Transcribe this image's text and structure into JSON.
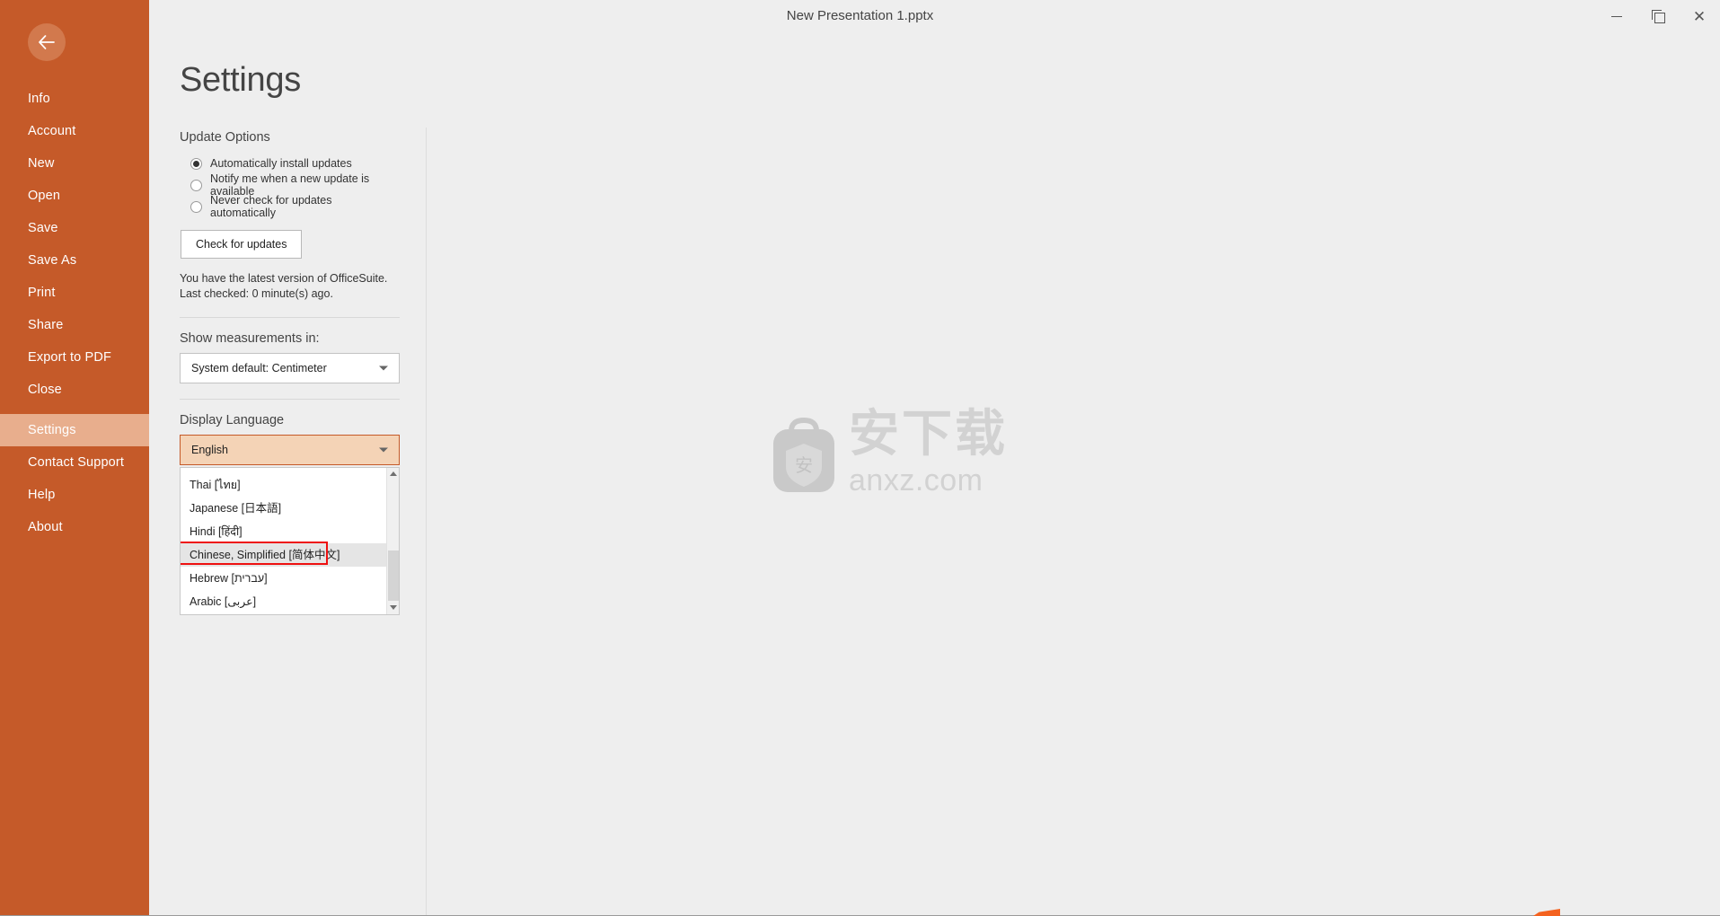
{
  "window": {
    "title": "New Presentation 1.pptx",
    "controls": {
      "minimize": "Minimize",
      "restore": "Restore",
      "close": "✕"
    }
  },
  "colors": {
    "sidebar_bg": "#c55a29",
    "sidebar_active_bg": "#e8ae8d",
    "accent_field_bg": "#f4d3b6",
    "accent_border": "#c55a29",
    "page_bg": "#eeeeee",
    "highlight_box": "#ee1111"
  },
  "sidebar": {
    "back_button": "back-arrow-icon",
    "items": [
      {
        "label": "Info",
        "active": false
      },
      {
        "label": "Account",
        "active": false
      },
      {
        "label": "New",
        "active": false
      },
      {
        "label": "Open",
        "active": false
      },
      {
        "label": "Save",
        "active": false
      },
      {
        "label": "Save As",
        "active": false
      },
      {
        "label": "Print",
        "active": false
      },
      {
        "label": "Share",
        "active": false
      },
      {
        "label": "Export to PDF",
        "active": false
      },
      {
        "label": "Close",
        "active": false
      },
      {
        "label": "Settings",
        "active": true
      },
      {
        "label": "Contact Support",
        "active": false
      },
      {
        "label": "Help",
        "active": false
      },
      {
        "label": "About",
        "active": false
      }
    ]
  },
  "page": {
    "title": "Settings"
  },
  "update_options": {
    "label": "Update Options",
    "radios": [
      {
        "label": "Automatically install updates",
        "selected": true
      },
      {
        "label": "Notify me when a new update is available",
        "selected": false
      },
      {
        "label": "Never check for updates automatically",
        "selected": false
      }
    ],
    "check_button": "Check for updates",
    "status_line_1": "You have the latest version of OfficeSuite.",
    "status_line_2": "Last checked: 0 minute(s) ago."
  },
  "measurements": {
    "label": "Show measurements in:",
    "selected": "System default: Centimeter"
  },
  "display_language": {
    "label": "Display Language",
    "selected": "English",
    "options": [
      {
        "label": "Thai [ไทย]",
        "highlighted": false
      },
      {
        "label": "Japanese [日本語]",
        "highlighted": false
      },
      {
        "label": "Hindi [हिंदी]",
        "highlighted": false
      },
      {
        "label": "Chinese, Simplified [简体中文]",
        "highlighted": true
      },
      {
        "label": "Hebrew [עברית]",
        "highlighted": false
      },
      {
        "label": "Arabic [عربى]",
        "highlighted": false
      }
    ],
    "scrollbar": {
      "up_arrow": "scroll-up-icon",
      "down_arrow": "scroll-down-icon"
    }
  },
  "watermark": {
    "cn_text": "安下载",
    "url": "anxz.com",
    "badge_char": "安"
  }
}
